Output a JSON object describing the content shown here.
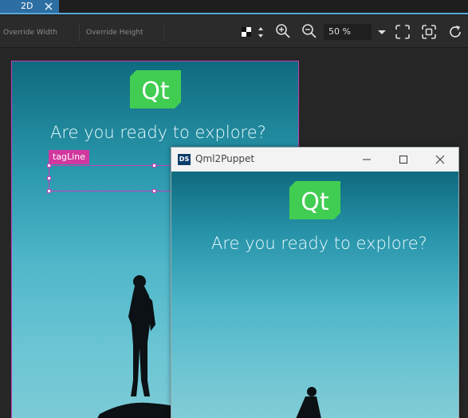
{
  "tabs": [
    {
      "label": "2D"
    }
  ],
  "toolbar": {
    "override_width_placeholder": "Override Width",
    "override_height_placeholder": "Override Height",
    "zoom_value": "50 %"
  },
  "canvas": {
    "selected_item_label": "tagLine",
    "headline": "Are you ready to explore?",
    "logo_text": "Qt"
  },
  "puppet_window": {
    "icon_text": "DS",
    "title": "Qml2Puppet",
    "headline": "Are you ready to explore?",
    "logo_text": "Qt"
  },
  "colors": {
    "accent_blue": "#57a6d8",
    "selection_magenta": "#c43fb8",
    "qt_green": "#41cd52"
  }
}
